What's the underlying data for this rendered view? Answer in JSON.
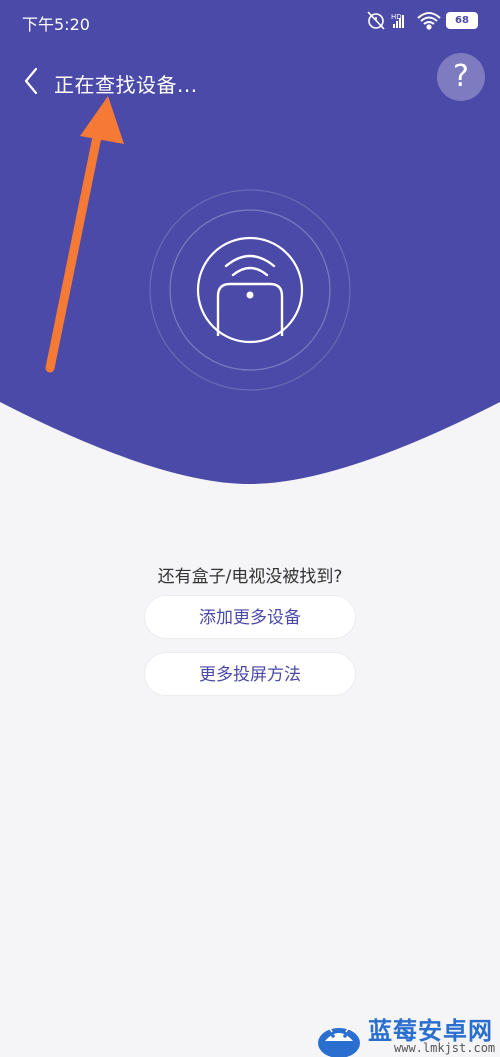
{
  "status_bar": {
    "time": "下午5:20",
    "battery": "68",
    "icons": [
      "alarm-off-icon",
      "signal-hd-icon",
      "wifi-icon",
      "battery-icon"
    ]
  },
  "header": {
    "title": "正在查找设备...",
    "back_icon": "chevron-left-icon",
    "help_label": "?"
  },
  "scan": {
    "icon": "tv-box-wifi-icon"
  },
  "content": {
    "not_found_text": "还有盒子/电视没被找到?",
    "add_more_label": "添加更多设备",
    "more_methods_label": "更多投屏方法"
  },
  "watermark": {
    "title": "蓝莓安卓网",
    "url": "www.lmkjst.com"
  },
  "colors": {
    "hero": "#4b4aa8",
    "accent": "#4b4aa8",
    "background": "#f5f5f7",
    "annotation_arrow": "#f47a36"
  }
}
